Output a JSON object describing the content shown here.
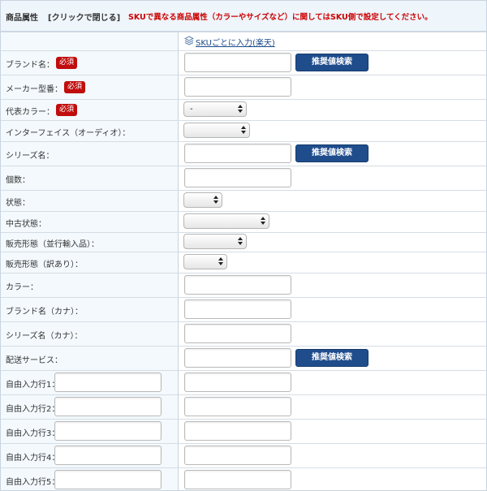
{
  "header": {
    "title": "商品属性",
    "toggle": "[クリックで閉じる]",
    "note": "SKUで異なる商品属性（カラーやサイズなど）に関してはSKU側で設定してください。"
  },
  "sku_link": "SKUごとに入力(楽天)",
  "required_badge": "必須",
  "search_button": "推奨値検索",
  "rows": [
    {
      "label": "ブランド名：",
      "required": true,
      "type": "text",
      "search": true
    },
    {
      "label": "メーカー型番：",
      "required": true,
      "type": "text",
      "search": false
    },
    {
      "label": "代表カラー：",
      "required": true,
      "type": "select",
      "value": "-"
    },
    {
      "label": "インターフェイス（オーディオ）：",
      "required": false,
      "type": "select",
      "value": ""
    },
    {
      "label": "シリーズ名：",
      "required": false,
      "type": "text",
      "search": true
    },
    {
      "label": "個数：",
      "required": false,
      "type": "text",
      "search": false
    },
    {
      "label": "状態：",
      "required": false,
      "type": "select",
      "value": ""
    },
    {
      "label": "中古状態：",
      "required": false,
      "type": "select",
      "value": ""
    },
    {
      "label": "販売形態（並行輸入品）：",
      "required": false,
      "type": "select",
      "value": ""
    },
    {
      "label": "販売形態（訳あり）：",
      "required": false,
      "type": "select",
      "value": ""
    },
    {
      "label": "カラー：",
      "required": false,
      "type": "text",
      "search": false
    },
    {
      "label": "ブランド名（カナ）：",
      "required": false,
      "type": "text",
      "search": false
    },
    {
      "label": "シリーズ名（カナ）：",
      "required": false,
      "type": "text",
      "search": false
    },
    {
      "label": "配送サービス：",
      "required": false,
      "type": "text",
      "search": true
    }
  ],
  "free_rows": [
    {
      "label": "自由入力行1："
    },
    {
      "label": "自由入力行2："
    },
    {
      "label": "自由入力行3："
    },
    {
      "label": "自由入力行4："
    },
    {
      "label": "自由入力行5："
    }
  ]
}
